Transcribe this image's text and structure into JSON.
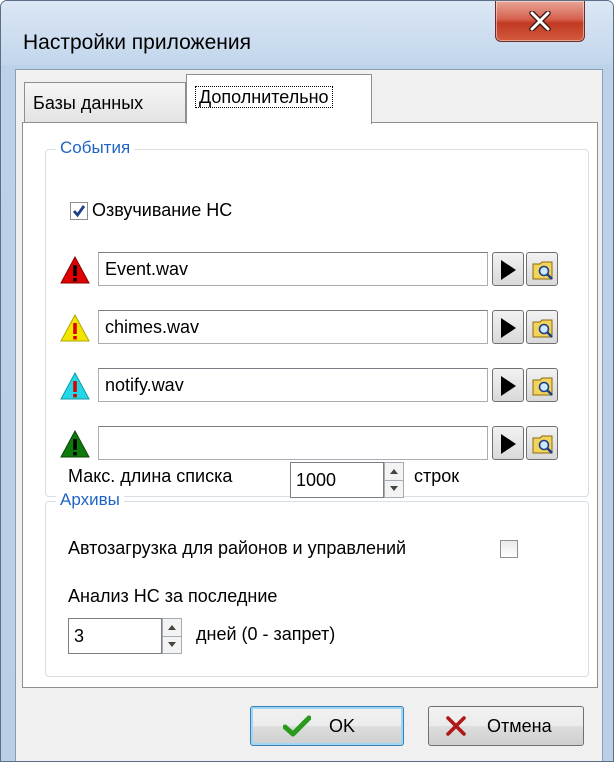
{
  "window": {
    "title": "Настройки приложения"
  },
  "tabs": [
    {
      "label": "Базы данных",
      "selected": false
    },
    {
      "label": "Дополнительно",
      "selected": true
    }
  ],
  "events": {
    "title": "События",
    "voice_checkbox": {
      "label": "Озвучивание НС",
      "checked": true
    },
    "sounds": [
      {
        "icon": "warning-red-icon",
        "color": "#e00000",
        "file": "Event.wav"
      },
      {
        "icon": "warning-yellow-icon",
        "color": "#f2e600",
        "file": "chimes.wav"
      },
      {
        "icon": "warning-cyan-icon",
        "color": "#22d8e6",
        "file": "notify.wav"
      },
      {
        "icon": "warning-green-icon",
        "color": "#0e7a0e",
        "file": ""
      }
    ],
    "max_list": {
      "label": "Макс. длина списка",
      "value": "1000",
      "unit": "строк"
    }
  },
  "archives": {
    "title": "Архивы",
    "autoload": {
      "label": "Автозагрузка для районов и управлений",
      "checked": false
    },
    "analysis": {
      "label": "Анализ НС за последние",
      "value": "3",
      "unit": "дней (0 - запрет)"
    }
  },
  "buttons": {
    "ok": "OK",
    "cancel": "Отмена"
  },
  "colors": {
    "group_title": "#1e64c8",
    "titlebar": "#c2d6ec",
    "close": "#c23a23"
  }
}
